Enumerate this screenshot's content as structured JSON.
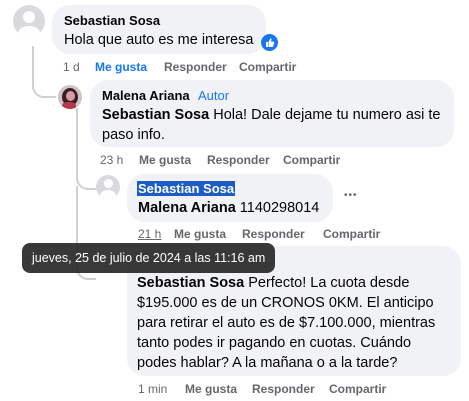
{
  "comments": [
    {
      "author": "Sebastian Sosa",
      "text": "Hola que auto es me interesa",
      "reaction": "like-icon",
      "time": "1 d",
      "like": "Me gusta",
      "reply": "Responder",
      "share": "Compartir"
    },
    {
      "author": "Malena Ariana",
      "badge": "Autor",
      "mention": "Sebastian Sosa",
      "text_line1": " Hola! Dale dejame tu numero asi te",
      "text_line2": "paso info.",
      "time": "23 h",
      "like": "Me gusta",
      "reply": "Responder",
      "share": "Compartir"
    },
    {
      "author": "Sebastian Sosa",
      "mention": "Malena Ariana",
      "text": " 1140298014",
      "more": "•••",
      "time": "21 h",
      "like": "Me gusta",
      "reply": "Responder",
      "share": "Compartir"
    },
    {
      "mention": "Sebastian Sosa",
      "lines": [
        " Perfecto! La cuota desde",
        "$195.000 es de un CRONOS 0KM. El anticipo",
        "para retirar el auto es de $7.100.000, mientras",
        "tanto podes ir pagando en cuotas. Cuándo",
        "podes hablar? A la mañana o a la tarde?"
      ],
      "time": "1 min",
      "like": "Me gusta",
      "reply": "Responder",
      "share": "Compartir"
    }
  ],
  "tooltip": "jueves, 25 de julio de 2024 a las 11:16 am",
  "colors": {
    "bubble": "#f0f2f5",
    "link_blue": "#1876f2",
    "selection": "#1d5cc5",
    "secondary_text": "#65676b"
  }
}
